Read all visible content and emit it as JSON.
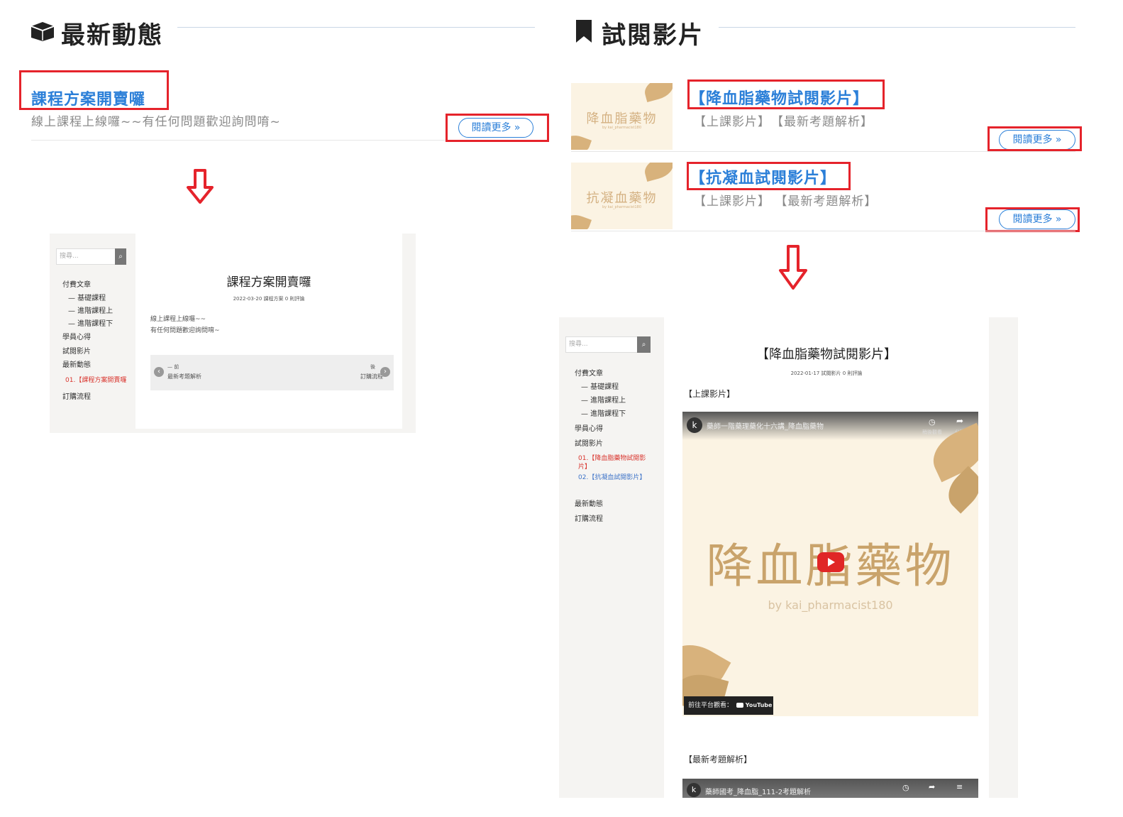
{
  "left": {
    "section_title": "最新動態",
    "post": {
      "title": "課程方案開賣囉",
      "excerpt": "線上課程上線囉~~有任何問題歡迎詢問唷~",
      "read_more": "閱讀更多 »"
    },
    "preview": {
      "search_placeholder": "搜尋...",
      "nav": [
        "付費文章",
        "— 基礎課程",
        "— 進階課程上",
        "— 進階課程下",
        "學員心得",
        "試閱影片",
        "最新動態"
      ],
      "nav_active": "01.【課程方案開賣囉",
      "nav_last": "訂購流程",
      "title": "課程方案開賣囉",
      "meta": "2022-03-20  課程方案  0 則評論",
      "body1": "線上課程上線囉~~",
      "body2": "有任何問題歡迎詢問唷~",
      "prev_label": "— 前",
      "prev_title": "最新考題解析",
      "next_label": "後",
      "next_title": "訂購流程"
    }
  },
  "right": {
    "section_title": "試閱影片",
    "posts": [
      {
        "title": "【降血脂藥物試閱影片】",
        "excerpt": "【上課影片】　【最新考題解析】",
        "thumb_text": "降血脂藥物",
        "thumb_sub": "by kai_pharmacist180",
        "read_more": "閱讀更多 »"
      },
      {
        "title": "【抗凝血試閱影片】",
        "excerpt": "【上課影片】 【最新考題解析】",
        "thumb_text": "抗凝血藥物",
        "thumb_sub": "by kai_pharmacist180",
        "read_more": "閱讀更多 »"
      }
    ],
    "preview": {
      "search_placeholder": "搜尋...",
      "nav": [
        "付費文章",
        "— 基礎課程",
        "— 進階課程上",
        "— 進階課程下",
        "學員心得",
        "試閱影片"
      ],
      "nav_active_1": "01.【降血脂藥物試閱影片】",
      "nav_active_2": "02.【抗凝血試閱影片】",
      "nav_after": [
        "最新動態",
        "訂購流程"
      ],
      "title": "【降血脂藥物試閱影片】",
      "meta": "2022-01-17  試閱影片  0 則評論",
      "section1": "【上課影片】",
      "video_channel": "k",
      "video_title": "藥師一階藥理藥化十六講_降血脂藥物",
      "video_watch_later": "稍後觀看",
      "video_share": "分享",
      "video_big_text": "降血脂藥物",
      "video_sub": "by kai_pharmacist180",
      "video_watch_on": "前往平台觀看：",
      "youtube": "YouTube",
      "section2": "【最新考題解析】",
      "video2_title": "藥師國考_降血脂_111-2考題解析"
    }
  },
  "colors": {
    "accent_blue": "#2b7fd8",
    "highlight_red": "#e5232b",
    "thumb_bg": "#fbf3e3",
    "thumb_gold": "#c9a36b"
  }
}
